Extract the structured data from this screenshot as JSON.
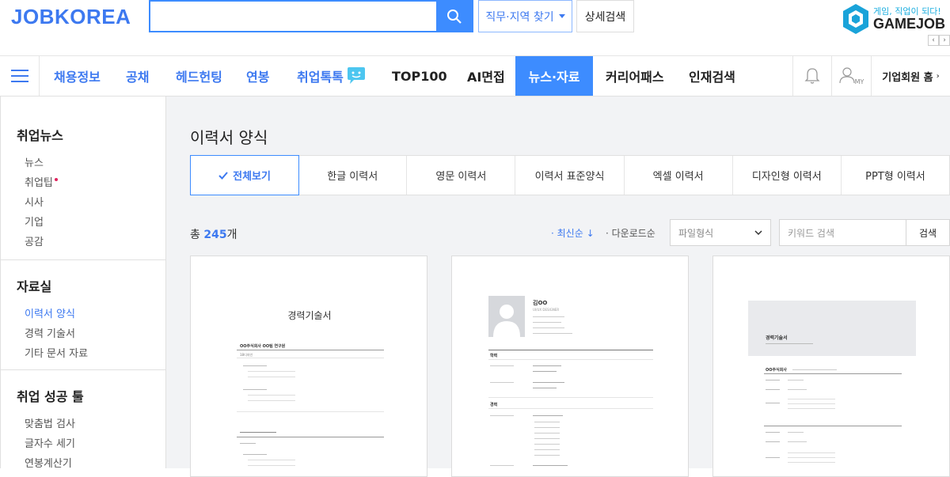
{
  "header": {
    "logo": "JOBKOREA",
    "search_placeholder": "",
    "filter_label": "직무·지역 찾기",
    "detail_search_label": "상세검색",
    "gamejob_tagline": "게임, 직업이 되다!",
    "gamejob_name": "GAMEJOB"
  },
  "nav": {
    "items": [
      "채용정보",
      "공채",
      "헤드헌팅",
      "연봉",
      "취업톡톡",
      "TOP100",
      "AI면접",
      "뉴스·자료",
      "커리어패스",
      "인재검색"
    ],
    "my_label": "MY",
    "corp_label": "기업회원 홈"
  },
  "sidebar": {
    "sections": [
      {
        "title": "취업뉴스",
        "items": [
          "뉴스",
          "취업팁",
          "시사",
          "기업",
          "공감"
        ]
      },
      {
        "title": "자료실",
        "items": [
          "이력서 양식",
          "경력 기술서",
          "기타 문서 자료"
        ]
      },
      {
        "title": "취업 성공 툴",
        "items": [
          "맞춤법 검사",
          "글자수 세기",
          "연봉계산기"
        ]
      }
    ]
  },
  "main": {
    "title": "이력서 양식",
    "tabs": [
      "전체보기",
      "한글 이력서",
      "영문 이력서",
      "이력서 표준양식",
      "엑셀 이력서",
      "디자인형 이력서",
      "PPT형 이력서"
    ],
    "count_prefix": "총",
    "count_value": "245",
    "count_suffix": "개",
    "sort_latest": "최신순 ↓",
    "sort_downloads": "다운로드순",
    "file_type_placeholder": "파일형식",
    "keyword_placeholder": "키워드 검색",
    "search_btn": "검색"
  },
  "cards": [
    {
      "title": "경력기술서",
      "company": "OO주식회사 OO팀 연구원",
      "period": "18디자인"
    },
    {
      "name": "김OO",
      "role": "UI/UX DESIGNER",
      "section1": "학력",
      "section2": "경력"
    },
    {
      "title": "경력기술서",
      "company": "OO주식회사"
    }
  ],
  "colors": {
    "accent": "#3d8cff",
    "brand": "#3d79f0"
  }
}
